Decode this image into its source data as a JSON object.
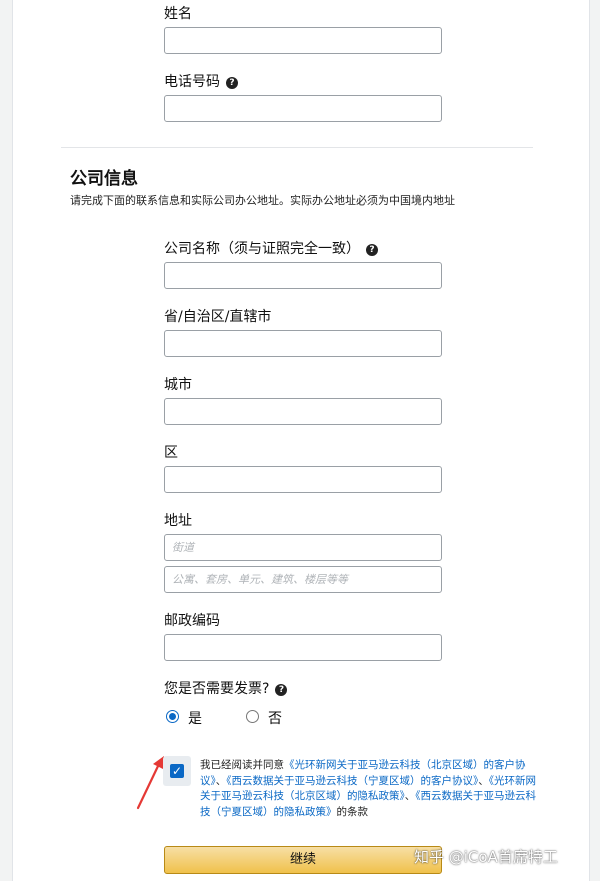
{
  "contact": {
    "name_label": "姓名",
    "phone_label": "电话号码"
  },
  "company": {
    "title": "公司信息",
    "description": "请完成下面的联系信息和实际公司办公地址。实际办公地址必须为中国境内地址",
    "name_label": "公司名称（须与证照完全一致）",
    "province_label": "省/自治区/直辖市",
    "city_label": "城市",
    "district_label": "区",
    "address_label": "地址",
    "address_line1_placeholder": "街道",
    "address_line2_placeholder": "公寓、套房、单元、建筑、楼层等等",
    "postal_label": "邮政编码"
  },
  "invoice": {
    "question": "您是否需要发票?",
    "options": [
      "是",
      "否"
    ],
    "selected": "是"
  },
  "agreement": {
    "checked": true,
    "prefix": "我已经阅读并同意",
    "link1": "《光环新网关于亚马逊云科技（北京区域）的客户协议》",
    "sep1": "、",
    "link2": "《西云数据关于亚马逊云科技（宁夏区域）的客户协议》",
    "sep2": "、",
    "link3": "《光环新网关于亚马逊云科技（北京区域）的隐私政策》",
    "sep3": "、",
    "link4": "《西云数据关于亚马逊云科技（宁夏区域）的隐私政策》",
    "suffix": "的条款"
  },
  "actions": {
    "continue_label": "继续"
  },
  "watermark": "知乎 @iCoA首席特工",
  "colors": {
    "accent": "#0a68c5",
    "button": "#f0c14b",
    "annotation_arrow": "#e53935"
  }
}
